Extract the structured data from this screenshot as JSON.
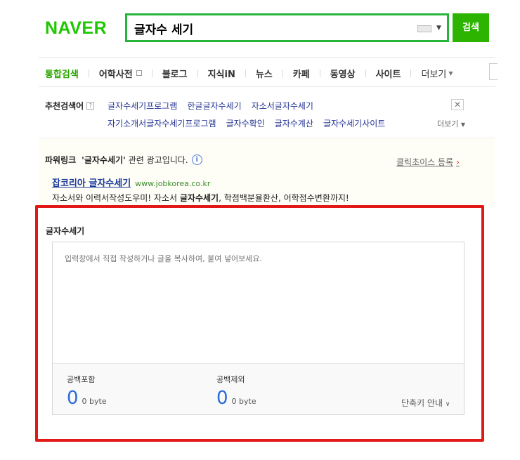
{
  "header": {
    "logo": "NAVER",
    "search_query": "글자수 세기",
    "search_button": "검색"
  },
  "tabs": [
    {
      "label": "통합검색",
      "active": true
    },
    {
      "label": "어학사전"
    },
    {
      "label": "블로그"
    },
    {
      "label": "지식iN"
    },
    {
      "label": "뉴스"
    },
    {
      "label": "카페"
    },
    {
      "label": "동영상"
    },
    {
      "label": "사이트"
    },
    {
      "label": "더보기"
    }
  ],
  "recommended": {
    "title": "추천검색어",
    "help": "?",
    "row1": [
      "글자수세기프로그램",
      "한글글자수세기",
      "자소서글자수세기"
    ],
    "row2": [
      "자기소개서글자수세기프로그램",
      "글자수확인",
      "글자수계산",
      "글자수세기사이트"
    ],
    "more": "더보기",
    "close": "✕"
  },
  "powerlink": {
    "label": "파워링크",
    "query": "'글자수세기'",
    "suffix": "관련 광고입니다.",
    "register": "클릭초이스 등록",
    "ad_title": "잡코리아 글자수세기",
    "ad_url": "www.jobkorea.co.kr",
    "ad_desc_before": "자소서와 이력서작성도우미! 자소서 ",
    "ad_desc_bold": "글자수세기",
    "ad_desc_after": ", 학점백분율환산, 어학점수변환까지!"
  },
  "widget": {
    "title": "글자수세기",
    "placeholder": "입력창에서 직접 작성하거나 글을 복사하여, 붙여 넣어보세요.",
    "with_space_label": "공백포함",
    "with_space_count": "0",
    "with_space_bytes": "0 byte",
    "without_space_label": "공백제외",
    "without_space_count": "0",
    "without_space_bytes": "0 byte",
    "shortcut": "단축키 안내"
  },
  "colors": {
    "brand": "#1ec800",
    "search_border": "#27b43b",
    "highlight": "#e21717",
    "count": "#2c6bd8"
  }
}
